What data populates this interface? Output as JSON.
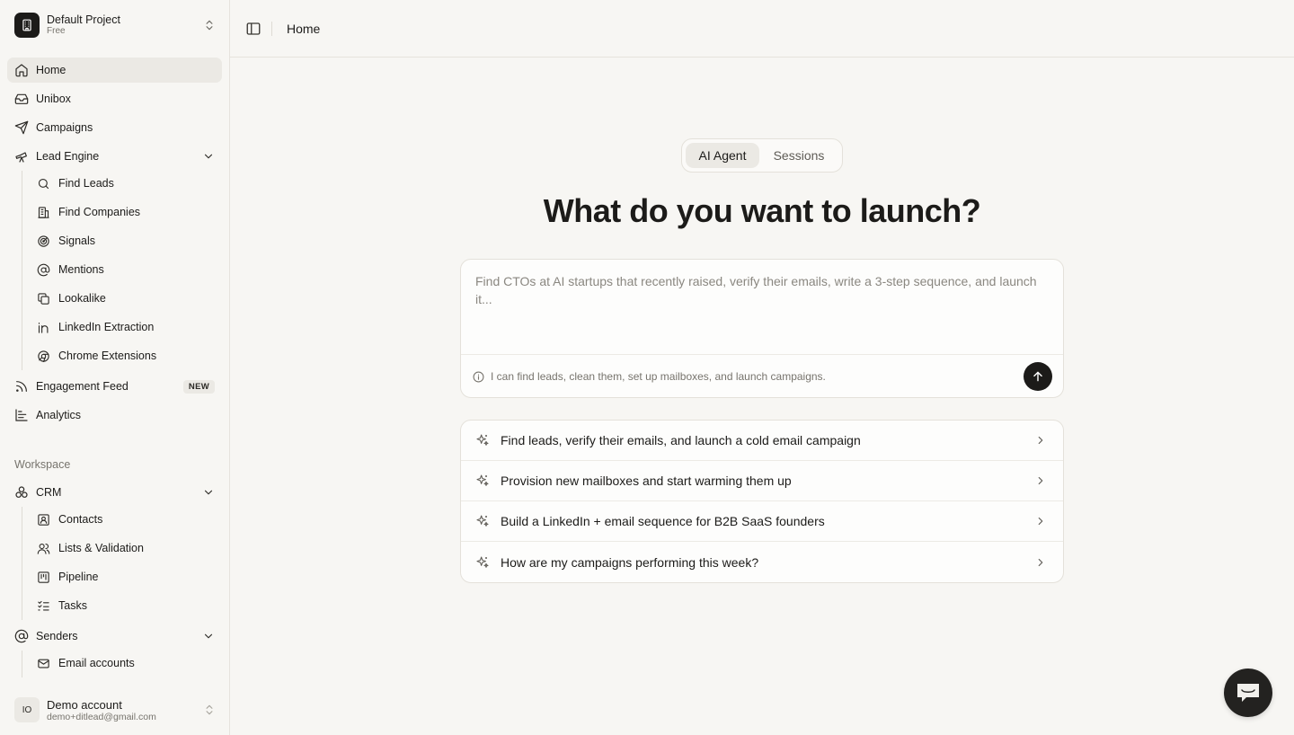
{
  "project": {
    "name": "Default Project",
    "plan": "Free"
  },
  "nav": {
    "home": "Home",
    "unibox": "Unibox",
    "campaigns": "Campaigns",
    "lead_engine": "Lead Engine",
    "lead_engine_items": [
      "Find Leads",
      "Find Companies",
      "Signals",
      "Mentions",
      "Lookalike",
      "LinkedIn Extraction",
      "Chrome Extensions"
    ],
    "engagement_feed": "Engagement Feed",
    "engagement_badge": "NEW",
    "analytics": "Analytics"
  },
  "workspace": {
    "label": "Workspace",
    "crm": "CRM",
    "crm_items": [
      "Contacts",
      "Lists & Validation",
      "Pipeline",
      "Tasks"
    ],
    "senders": "Senders",
    "senders_items": [
      "Email accounts"
    ]
  },
  "account": {
    "initials": "IO",
    "name": "Demo account",
    "email": "demo+ditlead@gmail.com"
  },
  "topbar": {
    "breadcrumb": "Home"
  },
  "main": {
    "tabs": [
      "AI Agent",
      "Sessions"
    ],
    "active_tab": "AI Agent",
    "headline": "What do you want to launch?",
    "prompt_placeholder": "Find CTOs at AI startups that recently raised, verify their emails, write a 3-step sequence, and launch it...",
    "prompt_hint": "I can find leads, clean them, set up mailboxes, and launch campaigns.",
    "suggestions": [
      "Find leads, verify their emails, and launch a cold email campaign",
      "Provision new mailboxes and start warming them up",
      "Build a LinkedIn + email sequence for B2B SaaS founders",
      "How are my campaigns performing this week?"
    ]
  }
}
